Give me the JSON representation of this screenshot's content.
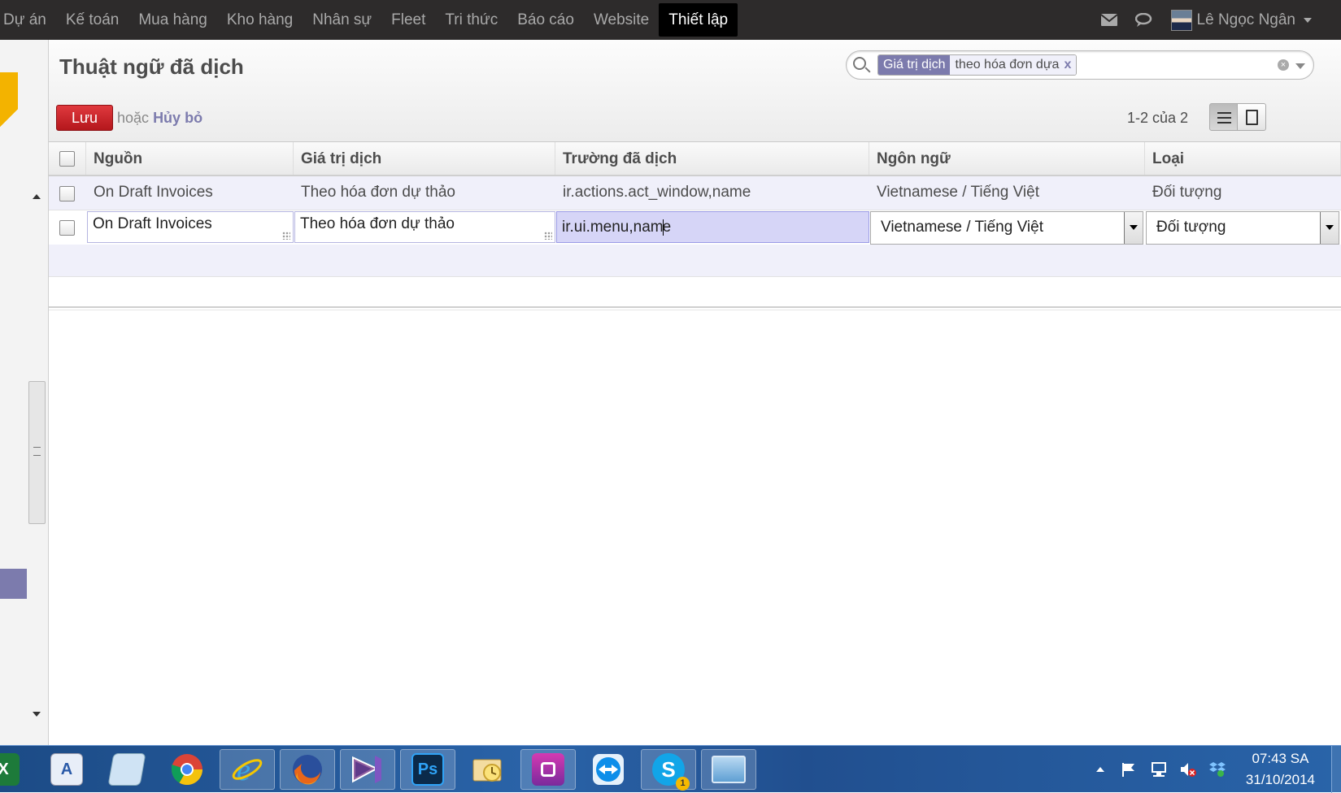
{
  "topmenu": {
    "items": [
      "Dự án",
      "Kế toán",
      "Mua hàng",
      "Kho hàng",
      "Nhân sự",
      "Fleet",
      "Tri thức",
      "Báo cáo",
      "Website",
      "Thiết lập"
    ],
    "active": "Thiết lập",
    "user": "Lê Ngọc Ngân",
    "icons": [
      "mail-icon",
      "chat-icon"
    ]
  },
  "page": {
    "title": "Thuật ngữ đã dịch",
    "save_label": "Lưu",
    "or_text": "hoặc",
    "discard_label": "Hủy bỏ",
    "pager": "1-2 của 2"
  },
  "search": {
    "facet_category": "Giá trị dịch",
    "facet_value": "theo hóa đơn dựa",
    "facet_remove": "x"
  },
  "table": {
    "columns": [
      "Nguồn",
      "Giá trị dịch",
      "Trường đã dịch",
      "Ngôn ngữ",
      "Loại"
    ],
    "rows": [
      [
        "On Draft Invoices",
        "Theo hóa đơn dự thảo",
        "ir.actions.act_window,name",
        "Vietnamese / Tiếng Việt",
        "Đối tượng"
      ]
    ],
    "edit_row": {
      "source": "On Draft Invoices",
      "value": "Theo hóa đơn dự thảo",
      "field_before_cursor": "ir.ui.menu,nam",
      "field_after_cursor": "e",
      "language": "Vietnamese / Tiếng Việt",
      "type": "Đối tượng"
    }
  },
  "taskbar": {
    "apps": [
      "excel-icon",
      "wordpad-icon",
      "notepad-icon",
      "chrome-icon",
      "ie-icon",
      "firefox-icon",
      "visual-studio-icon",
      "photoshop-icon",
      "outlook-icon",
      "media-icon",
      "teamviewer-icon",
      "skype-icon",
      "window-icon"
    ],
    "skype_badge": "1",
    "time": "07:43 SA",
    "date": "31/10/2014"
  },
  "colors": {
    "accent": "#7c7bad",
    "save": "#c9252b",
    "topbar": "#2d2b2b"
  }
}
